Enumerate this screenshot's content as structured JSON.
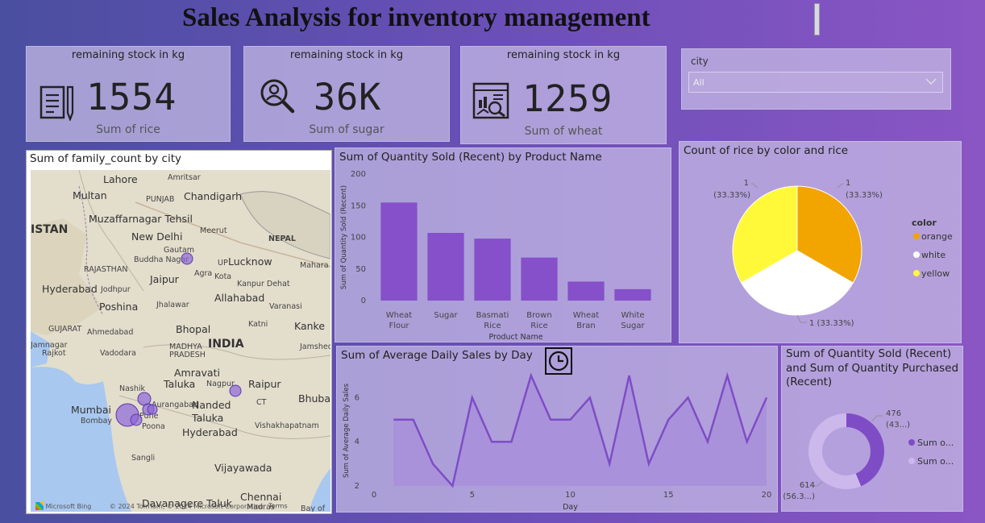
{
  "header": {
    "title": "Sales Analysis for inventory management"
  },
  "kpis": [
    {
      "title": "remaining stock in kg",
      "value": "1554",
      "label": "Sum of rice",
      "icon": "document-pen-icon"
    },
    {
      "title": "remaining stock in kg",
      "value": "36K",
      "label": "Sum of sugar",
      "icon": "magnifier-person-icon"
    },
    {
      "title": "remaining stock in kg",
      "value": "1259",
      "label": "Sum of wheat",
      "icon": "chart-analysis-icon"
    }
  ],
  "slicer": {
    "label": "city",
    "value": "All"
  },
  "map": {
    "title": "Sum of family_count by city",
    "attribution": "Microsoft Bing",
    "copyright": "© 2024 TomTom, © 2024 Microsoft Corporation",
    "terms": "Terms",
    "labels": {
      "lahore": "Lahore",
      "amritsar": "Amritsar",
      "multan": "Multan",
      "punjab": "PUNJAB",
      "chandigarh": "Chandigarh",
      "istan": "ISTAN",
      "muzaffarnagar": "Muzaffarnagar Tehsil",
      "meerut": "Meerut",
      "new_delhi": "New Delhi",
      "nepal": "NEPAL",
      "gautam": "Gautam",
      "buddha_nagar": "Buddha Nagar",
      "up": "UP",
      "lucknow": "Lucknow",
      "maharaj": "Mahara",
      "rajasthan": "RAJASTHAN",
      "jaipur": "Jaipur",
      "agra": "Agra",
      "kota": "Kota",
      "kanpur": "Kanpur Dehat",
      "hyderabad_pk": "Hyderabad",
      "jodhpur": "Jodhpur",
      "allahabad": "Allahabad",
      "varanasi": "Varanasi",
      "poshina": "Poshina",
      "jhalawar": "Jhalawar",
      "gujarat": "GUJARAT",
      "ahmedabad": "Ahmedabad",
      "bhopal": "Bhopal",
      "katni": "Katni",
      "kanke": "Kanke",
      "jamnagar": "Jamnagar",
      "rajkot": "Rajkot",
      "vadodara": "Vadodara",
      "madhya": "MADHYA",
      "pradesh": "PRADESH",
      "india": "INDIA",
      "jamshedpur": "Jamshedp",
      "amravati": "Amravati",
      "nashik": "Nashik",
      "taluka": "Taluka",
      "nagpur": "Nagpur",
      "raipur": "Raipur",
      "aurangabad": "Aurangabad",
      "ct": "CT",
      "bhubaneswar": "Bhuba",
      "mumbai": "Mumbai",
      "bombay": "Bombay",
      "pune": "Pune",
      "poona": "Poona",
      "nanded": "Nanded",
      "nanded_taluka": "Taluka",
      "vishakhapatnam": "Vishakhapatnam",
      "hyderabad": "Hyderabad",
      "sangli": "Sangli",
      "vijayawada": "Vijayawada",
      "davanagere": "Davanagere Taluk",
      "chennai": "Chennai",
      "madras": "Madras",
      "bay": "Bay of"
    }
  },
  "bar_chart": {
    "title": "Sum of Quantity Sold (Recent) by Product Name",
    "xlabel": "Product Name",
    "ylabel": "Sum of Quantity Sold (Recent)",
    "ticks": [
      "0",
      "50",
      "100",
      "150",
      "200"
    ],
    "categories_display": [
      [
        "Wheat",
        "Flour"
      ],
      [
        "Sugar"
      ],
      [
        "Basmati",
        "Rice"
      ],
      [
        "Brown",
        "Rice"
      ],
      [
        "Wheat",
        "Bran"
      ],
      [
        "White",
        "Sugar"
      ]
    ]
  },
  "pie_chart": {
    "title": "Count of rice by color and rice",
    "legend_title": "color",
    "legend": [
      "orange",
      "white",
      "yellow"
    ],
    "colors": {
      "orange": "#f2a400",
      "white": "#ffffff",
      "yellow": "#fff93a"
    },
    "data_labels": [
      {
        "count": "1",
        "pct": "(33.33%)"
      },
      {
        "count": "1",
        "pct": "(33.33%)"
      },
      {
        "label": "1 (33.33%)"
      }
    ]
  },
  "area_chart": {
    "title": "Sum of Average Daily Sales by Day",
    "xlabel": "Day",
    "ylabel": "Sum of Average Daily Sales",
    "xticks": [
      "0",
      "5",
      "10",
      "15",
      "20"
    ],
    "yticks": [
      "2",
      "4",
      "6"
    ],
    "icon": "clock-icon"
  },
  "donut_chart": {
    "title_lines": [
      "Sum of Quantity Sold (Recent)",
      "and Sum of Quantity Purchased",
      "(Recent)"
    ],
    "value_labels": [
      {
        "value": "476",
        "pct": "(43...)"
      },
      {
        "value": "614",
        "pct": "(56.3...)"
      }
    ],
    "legend": [
      "Sum o...",
      "Sum o..."
    ],
    "colors": [
      "#7e4dc6",
      "#cdb8ec"
    ]
  },
  "chart_data": [
    {
      "type": "bar",
      "title": "Sum of Quantity Sold (Recent) by Product Name",
      "categories": [
        "Wheat Flour",
        "Sugar",
        "Basmati Rice",
        "Brown Rice",
        "Wheat Bran",
        "White Sugar"
      ],
      "values": [
        155,
        107,
        98,
        68,
        30,
        18
      ],
      "xlabel": "Product Name",
      "ylabel": "Sum of Quantity Sold (Recent)",
      "ylim": [
        0,
        200
      ],
      "color": "#8550c9"
    },
    {
      "type": "pie",
      "title": "Count of rice by color and rice",
      "categories": [
        "orange",
        "white",
        "yellow"
      ],
      "values": [
        1,
        1,
        1
      ],
      "legend": "right"
    },
    {
      "type": "area",
      "title": "Sum of Average Daily Sales by Day",
      "x": [
        1,
        2,
        3,
        4,
        5,
        6,
        7,
        8,
        9,
        10,
        11,
        12,
        13,
        14,
        15,
        16,
        17,
        18,
        19,
        20
      ],
      "values": [
        5,
        5,
        3,
        2,
        6,
        4,
        4,
        7,
        5,
        5,
        6,
        3,
        7,
        3,
        5,
        6,
        4,
        7,
        4,
        6
      ],
      "xlabel": "Day",
      "ylabel": "Sum of Average Daily Sales",
      "xlim": [
        0,
        20
      ],
      "ylim": [
        2,
        7
      ],
      "color": "#7e4dc6"
    },
    {
      "type": "pie",
      "title": "Sum of Quantity Sold (Recent) and Sum of Quantity Purchased (Recent)",
      "values": [
        476,
        614
      ],
      "donut": true
    }
  ]
}
